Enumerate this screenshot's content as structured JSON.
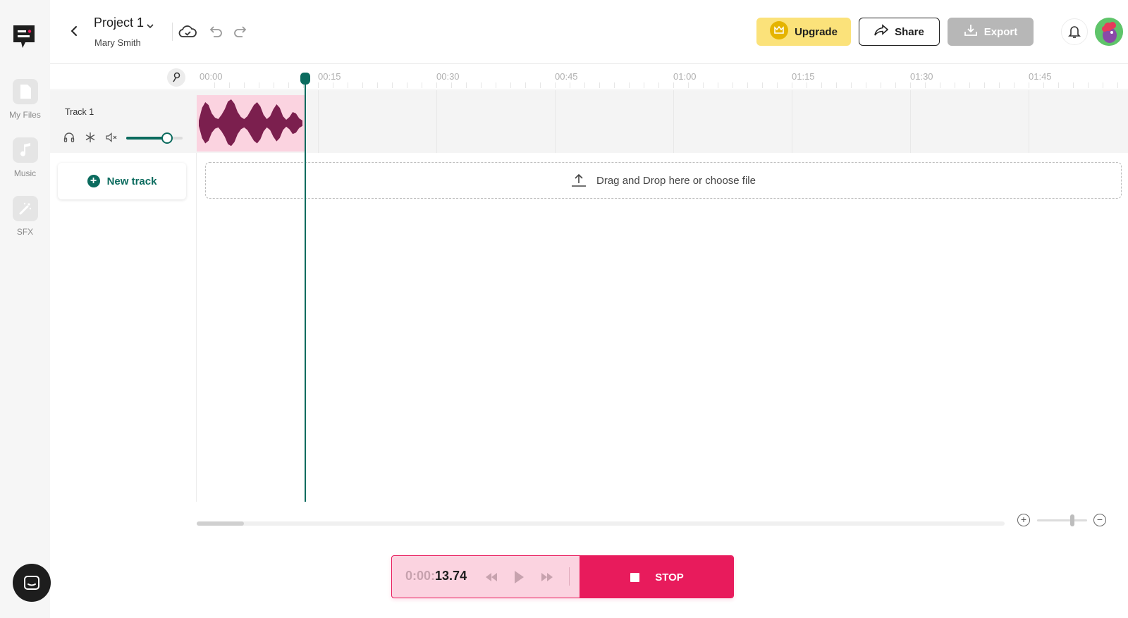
{
  "sidebar": {
    "items": [
      {
        "label": "My Files",
        "icon": "file-icon"
      },
      {
        "label": "Music",
        "icon": "music-note-icon"
      },
      {
        "label": "SFX",
        "icon": "magic-wand-icon"
      }
    ]
  },
  "header": {
    "project_title": "Project 1",
    "owner": "Mary Smith",
    "upgrade_label": "Upgrade",
    "share_label": "Share",
    "export_label": "Export"
  },
  "timeline": {
    "ticks": [
      "00:00",
      "00:15",
      "00:30",
      "00:45",
      "01:00",
      "01:15",
      "01:30",
      "01:45"
    ],
    "playhead_seconds": 13.74,
    "visible_seconds": 111
  },
  "tracks": [
    {
      "name": "Track 1",
      "volume": 0.72
    }
  ],
  "new_track_label": "New track",
  "dropzone_label": "Drag and Drop here or choose file",
  "transport": {
    "time_dim": "0:00:",
    "time_main": "13.74",
    "stop_label": "STOP"
  },
  "zoom_level": 0.7,
  "scroll_fraction": 0.06,
  "colors": {
    "accent": "#0b6b5e",
    "record": "#e81b5c",
    "clip_bg": "#fbd3e0",
    "waveform": "#7b1f4e",
    "upgrade": "#fbe27a"
  }
}
